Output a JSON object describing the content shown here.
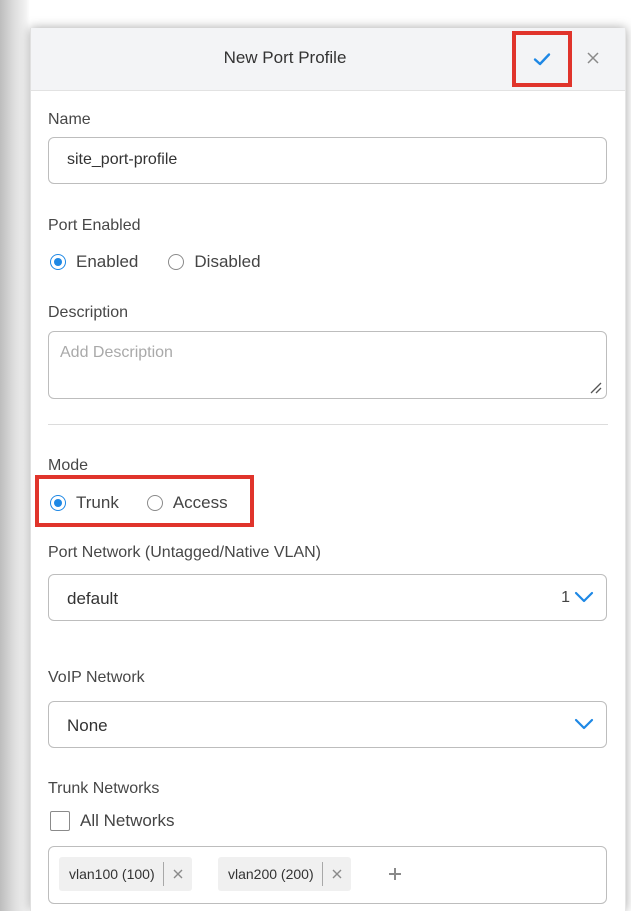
{
  "dialog": {
    "title": "New Port Profile",
    "save_icon": "check-icon",
    "close_icon": "close-icon"
  },
  "name": {
    "label": "Name",
    "value": "site_port-profile"
  },
  "port_enabled": {
    "label": "Port Enabled",
    "options": [
      "Enabled",
      "Disabled"
    ],
    "selected": "Enabled"
  },
  "description": {
    "label": "Description",
    "placeholder": "Add Description"
  },
  "mode": {
    "label": "Mode",
    "options": [
      "Trunk",
      "Access"
    ],
    "selected": "Trunk"
  },
  "port_network": {
    "label": "Port Network (Untagged/Native VLAN)",
    "value": "default",
    "count": "1"
  },
  "voip_network": {
    "label": "VoIP Network",
    "value": "None"
  },
  "trunk_networks": {
    "label": "Trunk Networks",
    "all_networks_label": "All Networks",
    "all_networks_checked": false,
    "tags": [
      "vlan100 (100)",
      "vlan200 (200)"
    ]
  },
  "colors": {
    "accent": "#1e88e5",
    "highlight": "#e0342b"
  }
}
